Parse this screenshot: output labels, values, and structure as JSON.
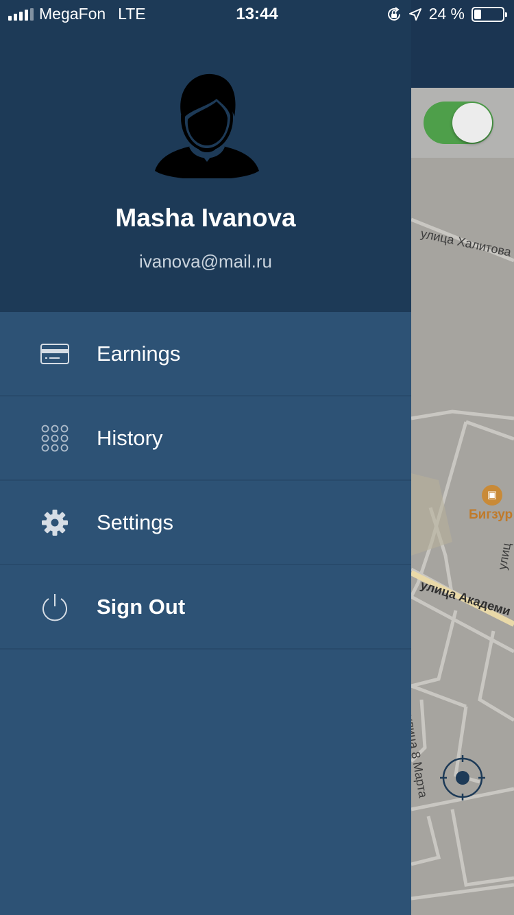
{
  "status_bar": {
    "carrier": "MegaFon",
    "network": "LTE",
    "time": "13:44",
    "battery_percent": "24 %",
    "battery_level": 0.24
  },
  "profile": {
    "name": "Masha Ivanova",
    "email": "ivanova@mail.ru"
  },
  "menu": {
    "items": [
      {
        "label": "Earnings",
        "icon": "credit-card-icon"
      },
      {
        "label": "History",
        "icon": "grid-dots-icon"
      },
      {
        "label": "Settings",
        "icon": "gear-icon"
      },
      {
        "label": "Sign Out",
        "icon": "power-icon"
      }
    ]
  },
  "map": {
    "toggle_on": true,
    "street_labels": [
      "улица Халитова",
      "улица Академи",
      "улица 8 Марта",
      "улиц"
    ],
    "poi_label": "Бигзур"
  },
  "colors": {
    "drawer_header": "#1d3a57",
    "drawer_body": "#2d5275",
    "toggle_on": "#4e9f4a",
    "poi": "#c07a2a"
  }
}
